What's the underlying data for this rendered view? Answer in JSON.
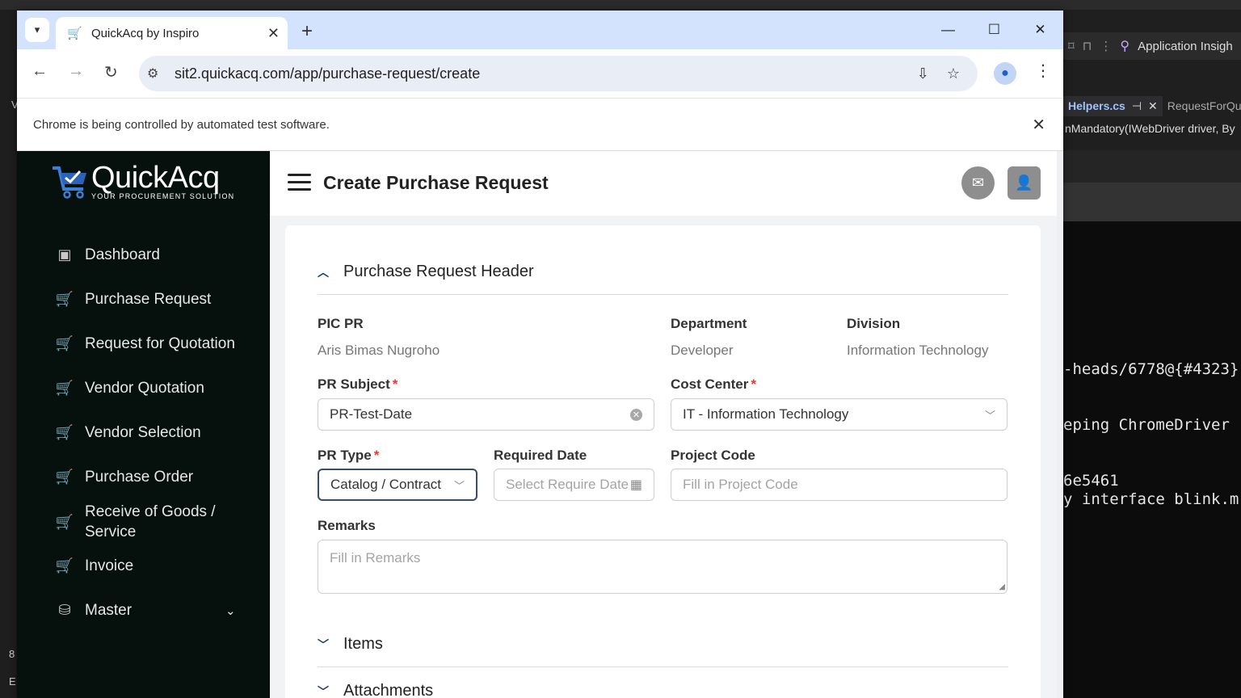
{
  "ide": {
    "toolbar_label": "Application Insigh",
    "tab_active": "Helpers.cs",
    "tab_active_pin": "⊣",
    "tab_active_close": "✕",
    "tab_second": "RequestForQu",
    "breadcrumb": "nMandatory(IWebDriver driver, By",
    "console_lines": [
      "-heads/6778@{#4323}",
      "eping ChromeDriver",
      "6e5461",
      "y interface blink.m"
    ],
    "left_strip_top": "V",
    "left_strip_bottom_1": "8",
    "left_strip_bottom_2": "E"
  },
  "browser": {
    "tab_title": "QuickAcq by Inspiro",
    "url": "sit2.quickacq.com/app/purchase-request/create",
    "infobar_text": "Chrome is being controlled by automated test software."
  },
  "app": {
    "logo_name": "QuickAcq",
    "logo_tagline": "YOUR PROCUREMENT SOLUTION",
    "page_title": "Create Purchase Request",
    "nav": [
      {
        "label": "Dashboard",
        "icon": "clipboard-icon"
      },
      {
        "label": "Purchase Request",
        "icon": "cart-icon"
      },
      {
        "label": "Request for Quotation",
        "icon": "cart-search-icon"
      },
      {
        "label": "Vendor Quotation",
        "icon": "cart-icon"
      },
      {
        "label": "Vendor Selection",
        "icon": "cart-star-icon"
      },
      {
        "label": "Purchase Order",
        "icon": "cart-icon"
      },
      {
        "label": "Receive of Goods /",
        "label2": "Service",
        "icon": "cart-down-icon"
      },
      {
        "label": "Invoice",
        "icon": "cart-icon"
      },
      {
        "label": "Master",
        "icon": "database-gear-icon"
      }
    ],
    "section_header": "Purchase Request Header",
    "section_items": "Items",
    "section_attachments": "Attachments",
    "form": {
      "pic_label": "PIC PR",
      "pic_value": "Aris Bimas Nugroho",
      "department_label": "Department",
      "department_value": "Developer",
      "division_label": "Division",
      "division_value": "Information Technology",
      "subject_label": "PR Subject",
      "subject_value": "PR-Test-Date",
      "cost_center_label": "Cost Center",
      "cost_center_value": "IT - Information Technology",
      "pr_type_label": "PR Type",
      "pr_type_value": "Catalog / Contract",
      "required_date_label": "Required Date",
      "required_date_placeholder": "Select Require Date",
      "project_code_label": "Project Code",
      "project_code_placeholder": "Fill in Project Code",
      "remarks_label": "Remarks",
      "remarks_placeholder": "Fill in Remarks",
      "required_mark": "*"
    }
  }
}
